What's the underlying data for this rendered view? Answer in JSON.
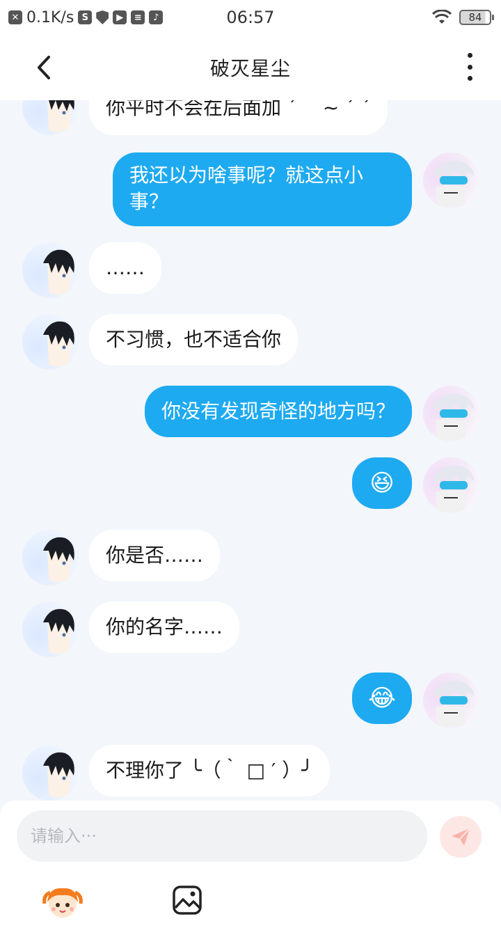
{
  "status_bar": {
    "speed": "0.1K/s",
    "time": "06:57",
    "battery": "84"
  },
  "header": {
    "title": "破灭星尘"
  },
  "messages": [
    {
      "sender": "other",
      "text": "你平时不会在后面加 ´ ｀~ ´ ´"
    },
    {
      "sender": "me",
      "text": "我还以为啥事呢？就这点小事？"
    },
    {
      "sender": "other",
      "text": "……"
    },
    {
      "sender": "other",
      "text": "不习惯，也不适合你"
    },
    {
      "sender": "me",
      "text": "你没有发现奇怪的地方吗？"
    },
    {
      "sender": "me",
      "text": "😆",
      "emoji": true
    },
    {
      "sender": "other",
      "text": "你是否……"
    },
    {
      "sender": "other",
      "text": "你的名字……"
    },
    {
      "sender": "me",
      "text": "😂",
      "emoji": true
    },
    {
      "sender": "other",
      "text": "不理你了 ╰（｀ □ ′ ）╯"
    }
  ],
  "composer": {
    "placeholder": "请输入···"
  },
  "colors": {
    "me_bubble": "#1eaaf1",
    "other_bubble": "#ffffff",
    "background": "#f3f6fa",
    "send_button": "#fde7e4"
  },
  "icons": {
    "back": "chevron-left-icon",
    "more": "more-vertical-icon",
    "send": "paper-plane-icon",
    "sticker": "sticker-character-icon",
    "image": "image-icon"
  }
}
